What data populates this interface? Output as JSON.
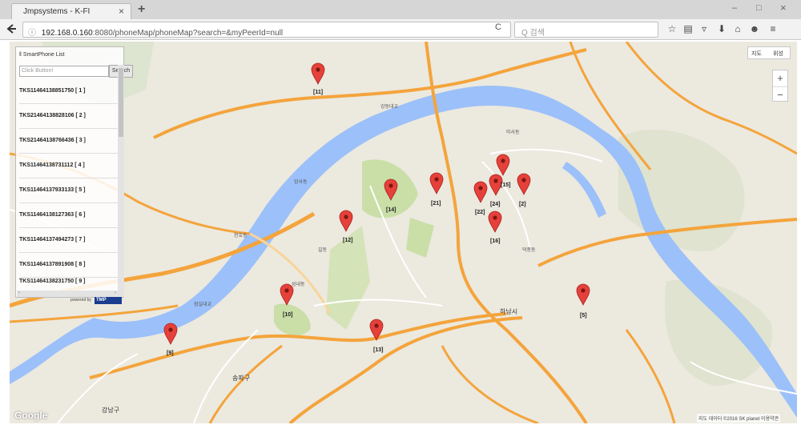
{
  "browser": {
    "tab_title": "Jmpsystems - K-FI",
    "tab_close": "×",
    "new_tab": "+",
    "url_info": "ⓘ",
    "url_host": "192.168.0.160",
    "url_rest": ":8080/phoneMap/phoneMap?search=&myPeerId=null",
    "search_placeholder": "Q 검색",
    "win_min": "–",
    "win_max": "□",
    "win_close": "×",
    "reload": "C"
  },
  "panel": {
    "title": "‖ SmartPhone List",
    "search_placeholder": "Click Button!",
    "search_button": "Search",
    "items": [
      "TKS11464138851750 [ 1 ]",
      "TKS21464138828106 [ 2 ]",
      "TKS21464138766436 [ 3 ]",
      "TKS11464138731112 [ 4 ]",
      "TKS11464137933133 [ 5 ]",
      "TKS11464138127363 [ 6 ]",
      "TKS11464137494273 [ 7 ]",
      "TKS11464137891908 [ 8 ]",
      "TKS11464138231750 [ 9 ]"
    ],
    "powered_by": "powered by",
    "logo": "TMP"
  },
  "map": {
    "mode_map": "지도",
    "mode_sat": "위성",
    "zoom_in": "+",
    "zoom_out": "−",
    "google": "Google",
    "copyright": "지도 데이터 ©2016 SK planet 이용약관",
    "markers": [
      {
        "label": "[11]"
      },
      {
        "label": "[14]"
      },
      {
        "label": "[21]"
      },
      {
        "label": "[22]"
      },
      {
        "label": "[24]"
      },
      {
        "label": "[15]"
      },
      {
        "label": "[2]"
      },
      {
        "label": "[12]"
      },
      {
        "label": "[16]"
      },
      {
        "label": "[10]"
      },
      {
        "label": "[5]"
      },
      {
        "label": "[13]"
      },
      {
        "label": "[9]"
      }
    ],
    "places": [
      "하남시",
      "송파구",
      "강남구",
      "천호동",
      "암사동",
      "길동",
      "성내동",
      "덕풍동",
      "미사동",
      "잠실대교",
      "강동대교"
    ],
    "colors": {
      "river": "#9cc0f9",
      "land": "#ece9df",
      "major_road": "#f4a43c",
      "park": "#c9dfa7",
      "marker": "#e5413a"
    }
  }
}
